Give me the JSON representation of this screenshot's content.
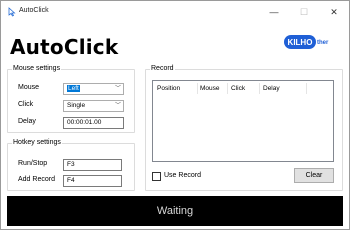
{
  "window": {
    "title": "AutoClick",
    "minimize_glyph": "—",
    "maximize_glyph": "☐",
    "close_glyph": "✕"
  },
  "header": {
    "title": "AutoClick",
    "logo_text": "KILHO",
    "logo_sub": "ther",
    "brand_color": "#1f5fd6"
  },
  "mouse_settings": {
    "group_label": "Mouse settings",
    "mouse_label": "Mouse",
    "mouse_value": "Left",
    "click_label": "Click",
    "click_value": "Single",
    "delay_label": "Delay",
    "delay_value": "00:00:01.00"
  },
  "hotkey_settings": {
    "group_label": "Hotkey settings",
    "run_stop_label": "Run/Stop",
    "run_stop_value": "F3",
    "add_record_label": "Add Record",
    "add_record_value": "F4"
  },
  "record": {
    "group_label": "Record",
    "columns": [
      "Position",
      "Mouse",
      "Click",
      "Delay"
    ],
    "use_record_label": "Use Record",
    "use_record_checked": false,
    "clear_label": "Clear"
  },
  "status": {
    "text": "Waiting"
  }
}
